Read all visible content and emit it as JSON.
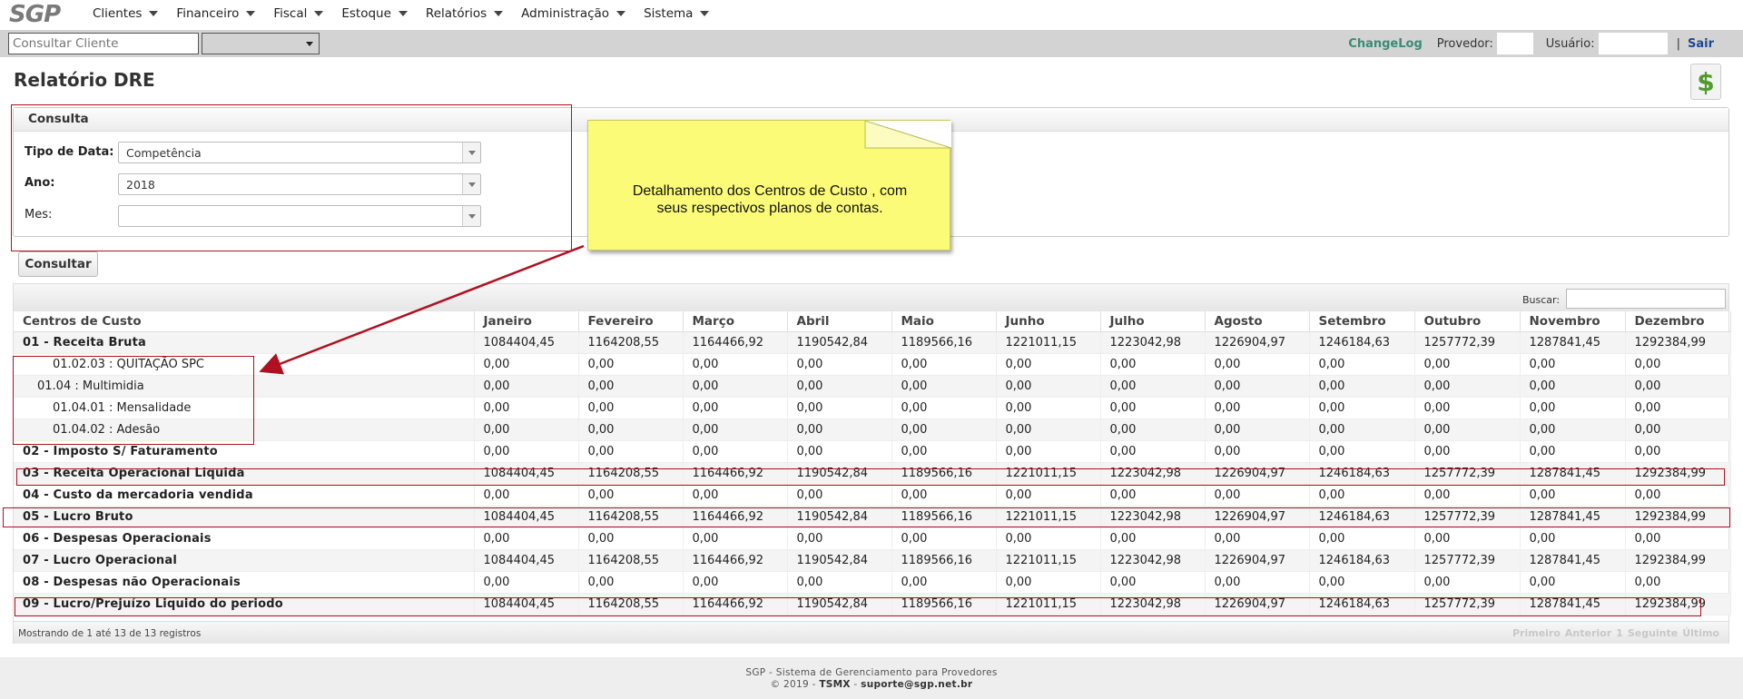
{
  "app": {
    "logo": "SGP"
  },
  "menu": [
    "Clientes",
    "Financeiro",
    "Fiscal",
    "Estoque",
    "Relatórios",
    "Administração",
    "Sistema"
  ],
  "search": {
    "placeholder": "Consultar Cliente",
    "select_value": ""
  },
  "top_right": {
    "changelog": "ChangeLog",
    "provedor_label": "Provedor:",
    "usuario_label": "Usuário:",
    "separator": "|",
    "logout": "Sair"
  },
  "page": {
    "title": "Relatório DRE",
    "icon": "dollar-icon"
  },
  "consulta": {
    "title": "Consulta",
    "tipo_label": "Tipo de Data:",
    "tipo_value": "Competência",
    "ano_label": "Ano:",
    "ano_value": "2018",
    "mes_label": "Mes:",
    "mes_value": "",
    "button": "Consultar"
  },
  "note": {
    "text": "Detalhamento dos Centros de Custo , com seus respectivos planos de contas."
  },
  "table": {
    "search_label": "Buscar:",
    "columns": [
      "Centros de Custo",
      "Janeiro",
      "Fevereiro",
      "Março",
      "Abril",
      "Maio",
      "Junho",
      "Julho",
      "Agosto",
      "Setembro",
      "Outubro",
      "Novembro",
      "Dezembro"
    ],
    "rows": [
      {
        "label": "01 - Receita Bruta",
        "style": "bold",
        "values": [
          "1084404,45",
          "1164208,55",
          "1164466,92",
          "1190542,84",
          "1189566,16",
          "1221011,15",
          "1223042,98",
          "1226904,97",
          "1246184,63",
          "1257772,39",
          "1287841,45",
          "1292384,99"
        ]
      },
      {
        "label": "01.02.03 : QUITAÇÃO SPC",
        "style": "ind2",
        "values": [
          "0,00",
          "0,00",
          "0,00",
          "0,00",
          "0,00",
          "0,00",
          "0,00",
          "0,00",
          "0,00",
          "0,00",
          "0,00",
          "0,00"
        ]
      },
      {
        "label": "01.04 : Multimidia",
        "style": "ind1",
        "values": [
          "0,00",
          "0,00",
          "0,00",
          "0,00",
          "0,00",
          "0,00",
          "0,00",
          "0,00",
          "0,00",
          "0,00",
          "0,00",
          "0,00"
        ]
      },
      {
        "label": "01.04.01 : Mensalidade",
        "style": "ind2",
        "values": [
          "0,00",
          "0,00",
          "0,00",
          "0,00",
          "0,00",
          "0,00",
          "0,00",
          "0,00",
          "0,00",
          "0,00",
          "0,00",
          "0,00"
        ]
      },
      {
        "label": "01.04.02 : Adesão",
        "style": "ind2",
        "values": [
          "0,00",
          "0,00",
          "0,00",
          "0,00",
          "0,00",
          "0,00",
          "0,00",
          "0,00",
          "0,00",
          "0,00",
          "0,00",
          "0,00"
        ]
      },
      {
        "label": "02 - Imposto S/ Faturamento",
        "style": "bold",
        "values": [
          "0,00",
          "0,00",
          "0,00",
          "0,00",
          "0,00",
          "0,00",
          "0,00",
          "0,00",
          "0,00",
          "0,00",
          "0,00",
          "0,00"
        ]
      },
      {
        "label": "03 - Receita Operacional Liquida",
        "style": "bold",
        "values": [
          "1084404,45",
          "1164208,55",
          "1164466,92",
          "1190542,84",
          "1189566,16",
          "1221011,15",
          "1223042,98",
          "1226904,97",
          "1246184,63",
          "1257772,39",
          "1287841,45",
          "1292384,99"
        ]
      },
      {
        "label": "04 - Custo da mercadoria vendida",
        "style": "bold",
        "values": [
          "0,00",
          "0,00",
          "0,00",
          "0,00",
          "0,00",
          "0,00",
          "0,00",
          "0,00",
          "0,00",
          "0,00",
          "0,00",
          "0,00"
        ]
      },
      {
        "label": "05 - Lucro Bruto",
        "style": "bold",
        "values": [
          "1084404,45",
          "1164208,55",
          "1164466,92",
          "1190542,84",
          "1189566,16",
          "1221011,15",
          "1223042,98",
          "1226904,97",
          "1246184,63",
          "1257772,39",
          "1287841,45",
          "1292384,99"
        ]
      },
      {
        "label": "06 - Despesas Operacionais",
        "style": "bold",
        "values": [
          "0,00",
          "0,00",
          "0,00",
          "0,00",
          "0,00",
          "0,00",
          "0,00",
          "0,00",
          "0,00",
          "0,00",
          "0,00",
          "0,00"
        ]
      },
      {
        "label": "07 - Lucro Operacional",
        "style": "bold",
        "values": [
          "1084404,45",
          "1164208,55",
          "1164466,92",
          "1190542,84",
          "1189566,16",
          "1221011,15",
          "1223042,98",
          "1226904,97",
          "1246184,63",
          "1257772,39",
          "1287841,45",
          "1292384,99"
        ]
      },
      {
        "label": "08 - Despesas não Operacionais",
        "style": "bold",
        "values": [
          "0,00",
          "0,00",
          "0,00",
          "0,00",
          "0,00",
          "0,00",
          "0,00",
          "0,00",
          "0,00",
          "0,00",
          "0,00",
          "0,00"
        ]
      },
      {
        "label": "09 - Lucro/Prejuízo Liquido do periodo",
        "style": "bold",
        "values": [
          "1084404,45",
          "1164208,55",
          "1164466,92",
          "1190542,84",
          "1189566,16",
          "1221011,15",
          "1223042,98",
          "1226904,97",
          "1246184,63",
          "1257772,39",
          "1287841,45",
          "1292384,99"
        ]
      }
    ],
    "info": "Mostrando de 1 até 13 de 13 registros",
    "pager": [
      "Primeiro",
      "Anterior",
      "1",
      "Seguinte",
      "Último"
    ]
  },
  "footer": {
    "line1": "SGP - Sistema de Gerenciamento para Provedores",
    "line2_prefix": "© 2019 - ",
    "company": "TSMX",
    "line2_mid": " - ",
    "email": "suporte@sgp.net.br"
  },
  "colors": {
    "annotation_red": "#b01020",
    "note_yellow": "#fbfb78",
    "changelog_green": "#3a8c74",
    "logout_blue": "#1b4a90"
  }
}
